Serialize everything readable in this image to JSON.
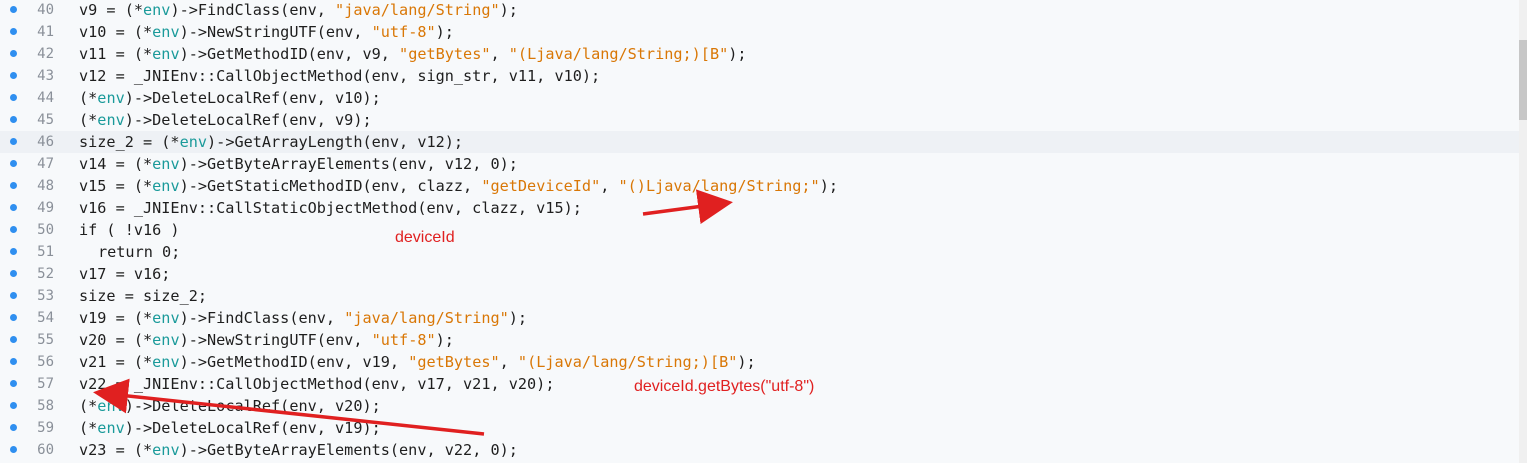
{
  "lines": [
    {
      "n": "40",
      "segs": [
        [
          "v9 = (*",
          "var"
        ],
        [
          "env",
          "ty"
        ],
        [
          ")->FindClass(env, ",
          "fn"
        ],
        [
          "\"java/lang/String\"",
          "str"
        ],
        [
          ");",
          "fn"
        ]
      ]
    },
    {
      "n": "41",
      "segs": [
        [
          "v10 = (*",
          "var"
        ],
        [
          "env",
          "ty"
        ],
        [
          ")->NewStringUTF(env, ",
          "fn"
        ],
        [
          "\"utf-8\"",
          "str"
        ],
        [
          ");",
          "fn"
        ]
      ]
    },
    {
      "n": "42",
      "segs": [
        [
          "v11 = (*",
          "var"
        ],
        [
          "env",
          "ty"
        ],
        [
          ")->GetMethodID(env, v9, ",
          "fn"
        ],
        [
          "\"getBytes\"",
          "str"
        ],
        [
          ", ",
          "fn"
        ],
        [
          "\"(Ljava/lang/String;)[B\"",
          "str"
        ],
        [
          ");",
          "fn"
        ]
      ]
    },
    {
      "n": "43",
      "segs": [
        [
          "v12 = _JNIEnv::CallObjectMethod(env, sign_str, v11, v10);",
          "fn"
        ]
      ]
    },
    {
      "n": "44",
      "segs": [
        [
          "(*",
          "var"
        ],
        [
          "env",
          "ty"
        ],
        [
          ")->DeleteLocalRef(env, v10);",
          "fn"
        ]
      ]
    },
    {
      "n": "45",
      "segs": [
        [
          "(*",
          "var"
        ],
        [
          "env",
          "ty"
        ],
        [
          ")->DeleteLocalRef(env, v9);",
          "fn"
        ]
      ]
    },
    {
      "n": "46",
      "segs": [
        [
          "size_2 = (*",
          "var"
        ],
        [
          "env",
          "ty"
        ],
        [
          ")->GetArrayLength(env, v12);",
          "fn"
        ]
      ]
    },
    {
      "n": "47",
      "segs": [
        [
          "v14 = (*",
          "var"
        ],
        [
          "env",
          "ty"
        ],
        [
          ")->GetByteArrayElements(env, v12, 0);",
          "fn"
        ]
      ]
    },
    {
      "n": "48",
      "segs": [
        [
          "v15 = (*",
          "var"
        ],
        [
          "env",
          "ty"
        ],
        [
          ")->GetStaticMethodID(env, clazz, ",
          "fn"
        ],
        [
          "\"getDeviceId\"",
          "str"
        ],
        [
          ", ",
          "fn"
        ],
        [
          "\"()Ljava/lang/String;\"",
          "str"
        ],
        [
          ");",
          "fn"
        ]
      ]
    },
    {
      "n": "49",
      "segs": [
        [
          "v16 = _JNIEnv::CallStaticObjectMethod(env, clazz, v15);",
          "fn"
        ]
      ]
    },
    {
      "n": "50",
      "segs": [
        [
          "if ( !v16 )",
          "kw"
        ]
      ]
    },
    {
      "n": "51",
      "indent": true,
      "segs": [
        [
          "return 0;",
          "kw"
        ]
      ]
    },
    {
      "n": "52",
      "segs": [
        [
          "v17 = v16;",
          "var"
        ]
      ]
    },
    {
      "n": "53",
      "segs": [
        [
          "size = size_2;",
          "var"
        ]
      ]
    },
    {
      "n": "54",
      "segs": [
        [
          "v19 = (*",
          "var"
        ],
        [
          "env",
          "ty"
        ],
        [
          ")->FindClass(env, ",
          "fn"
        ],
        [
          "\"java/lang/String\"",
          "str"
        ],
        [
          ");",
          "fn"
        ]
      ]
    },
    {
      "n": "55",
      "segs": [
        [
          "v20 = (*",
          "var"
        ],
        [
          "env",
          "ty"
        ],
        [
          ")->NewStringUTF(env, ",
          "fn"
        ],
        [
          "\"utf-8\"",
          "str"
        ],
        [
          ");",
          "fn"
        ]
      ]
    },
    {
      "n": "56",
      "segs": [
        [
          "v21 = (*",
          "var"
        ],
        [
          "env",
          "ty"
        ],
        [
          ")->GetMethodID(env, v19, ",
          "fn"
        ],
        [
          "\"getBytes\"",
          "str"
        ],
        [
          ", ",
          "fn"
        ],
        [
          "\"(Ljava/lang/String;)[B\"",
          "str"
        ],
        [
          ");",
          "fn"
        ]
      ]
    },
    {
      "n": "57",
      "segs": [
        [
          "v22 = _JNIEnv::CallObjectMethod(env, v17, v21, v20);",
          "fn"
        ]
      ]
    },
    {
      "n": "58",
      "segs": [
        [
          "(*",
          "var"
        ],
        [
          "env",
          "ty"
        ],
        [
          ")->DeleteLocalRef(env, v20);",
          "fn"
        ]
      ]
    },
    {
      "n": "59",
      "segs": [
        [
          "(*",
          "var"
        ],
        [
          "env",
          "ty"
        ],
        [
          ")->DeleteLocalRef(env, v19);",
          "fn"
        ]
      ]
    },
    {
      "n": "60",
      "segs": [
        [
          "v23 = (*",
          "var"
        ],
        [
          "env",
          "ty"
        ],
        [
          ")->GetByteArrayElements(env, v22, 0);",
          "fn"
        ]
      ]
    }
  ],
  "highlighted_line": "46",
  "annotations": {
    "deviceid": "deviceId",
    "getbytes": "deviceId.getBytes(\"utf-8\")"
  },
  "colors": {
    "string": "#d97706",
    "type": "#1a9a9a",
    "breakpoint": "#2f8ff0",
    "annotation": "#e02020"
  }
}
